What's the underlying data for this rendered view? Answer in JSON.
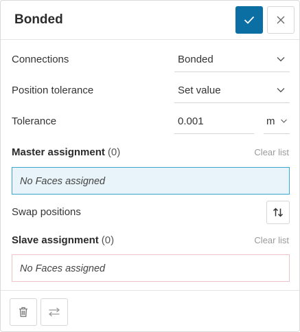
{
  "header": {
    "title": "Bonded",
    "confirm_icon": "check-icon",
    "close_icon": "close-icon"
  },
  "connections": {
    "label": "Connections",
    "value": "Bonded"
  },
  "position_tolerance": {
    "label": "Position tolerance",
    "value": "Set value"
  },
  "tolerance": {
    "label": "Tolerance",
    "value": "0.001",
    "unit": "m"
  },
  "master": {
    "title": "Master assignment",
    "count": "(0)",
    "clear_label": "Clear list",
    "empty_text": "No Faces assigned"
  },
  "swap": {
    "label": "Swap positions",
    "icon": "swap-vertical-icon"
  },
  "slave": {
    "title": "Slave assignment",
    "count": "(0)",
    "clear_label": "Clear list",
    "empty_text": "No Faces assigned"
  },
  "footer": {
    "delete_icon": "trash-icon",
    "swap_icon": "swap-horizontal-icon"
  },
  "colors": {
    "accent": "#0b6fa4",
    "master_bg": "#e8f4fa",
    "master_border": "#3aa6d0",
    "slave_border": "#efc4c8"
  }
}
